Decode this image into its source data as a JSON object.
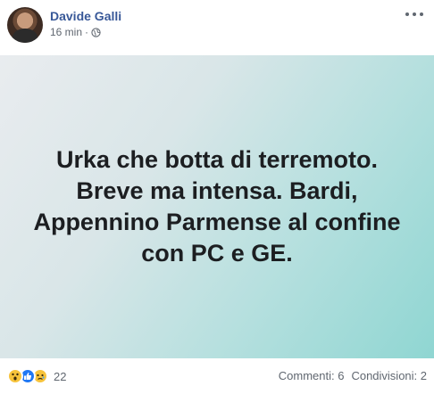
{
  "post": {
    "author": "Davide Galli",
    "time": "16 min",
    "separator": "·",
    "status_text": "Urka che botta di terremoto. Breve ma intensa. Bardi, Appennino Parmense al confine con PC e GE.",
    "reactions": {
      "icons": [
        "wow-icon",
        "like-icon",
        "sad-icon"
      ],
      "count": "22"
    },
    "comments_label": "Commenti: 6",
    "shares_label": "Condivisioni: 2"
  },
  "colors": {
    "author_link": "#385898",
    "meta_text": "#606770",
    "like_blue": "#2078f4",
    "emoji_yellow": "#f7c33b",
    "background_gradient_start": "#e9ecef",
    "background_gradient_end": "#8fd6d2"
  }
}
